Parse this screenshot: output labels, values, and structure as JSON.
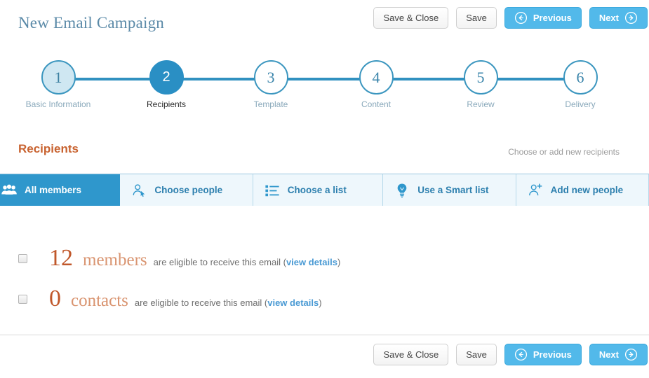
{
  "header": {
    "title": "New Email Campaign",
    "buttons": [
      {
        "label": "Save & Close",
        "name": "save-close-button",
        "style": "plain"
      },
      {
        "label": "Save",
        "name": "save-button",
        "style": "plain"
      },
      {
        "label": "Previous",
        "name": "previous-button",
        "style": "blue",
        "icon": "arrow-left-circle-icon",
        "icon_side": "left"
      },
      {
        "label": "Next",
        "name": "next-button",
        "style": "blue",
        "icon": "arrow-right-circle-icon",
        "icon_side": "right"
      }
    ]
  },
  "stepper": {
    "steps": [
      {
        "number": "1",
        "label": "Basic Information",
        "state": "done"
      },
      {
        "number": "2",
        "label": "Recipients",
        "state": "active"
      },
      {
        "number": "3",
        "label": "Template",
        "state": "todo"
      },
      {
        "number": "4",
        "label": "Content",
        "state": "todo"
      },
      {
        "number": "5",
        "label": "Review",
        "state": "todo"
      },
      {
        "number": "6",
        "label": "Delivery",
        "state": "todo"
      }
    ]
  },
  "section": {
    "title": "Recipients",
    "hint": "Choose or add new recipients"
  },
  "tabs": [
    {
      "label": "All members",
      "icon": "group-people-icon",
      "active": true
    },
    {
      "label": "Choose people",
      "icon": "person-cursor-icon",
      "active": false
    },
    {
      "label": "Choose a list",
      "icon": "bulleted-list-icon",
      "active": false
    },
    {
      "label": "Use a Smart list",
      "icon": "lightbulb-icon",
      "active": false
    },
    {
      "label": "Add new people",
      "icon": "person-plus-icon",
      "active": false
    }
  ],
  "recipient_rows": [
    {
      "count": "12",
      "kind": "members",
      "rest_prefix": "are eligible to receive this email (",
      "link": "view details",
      "rest_suffix": ")",
      "checked": false
    },
    {
      "count": "0",
      "kind": "contacts",
      "rest_prefix": "are eligible to receive this email (",
      "link": "view details",
      "rest_suffix": ")",
      "checked": false
    }
  ],
  "footer": {
    "buttons": [
      {
        "label": "Save & Close",
        "name": "save-close-button",
        "style": "plain"
      },
      {
        "label": "Save",
        "name": "save-button",
        "style": "plain"
      },
      {
        "label": "Previous",
        "name": "previous-button",
        "style": "blue",
        "icon": "arrow-left-circle-icon",
        "icon_side": "left"
      },
      {
        "label": "Next",
        "name": "next-button",
        "style": "blue",
        "icon": "arrow-right-circle-icon",
        "icon_side": "right"
      }
    ]
  },
  "colors": {
    "brand_blue": "#2f97cc",
    "button_blue": "#52b9ea",
    "accent_orange": "#c8622f",
    "title_blue": "#5b8aa8",
    "step_line": "#3191c0"
  }
}
